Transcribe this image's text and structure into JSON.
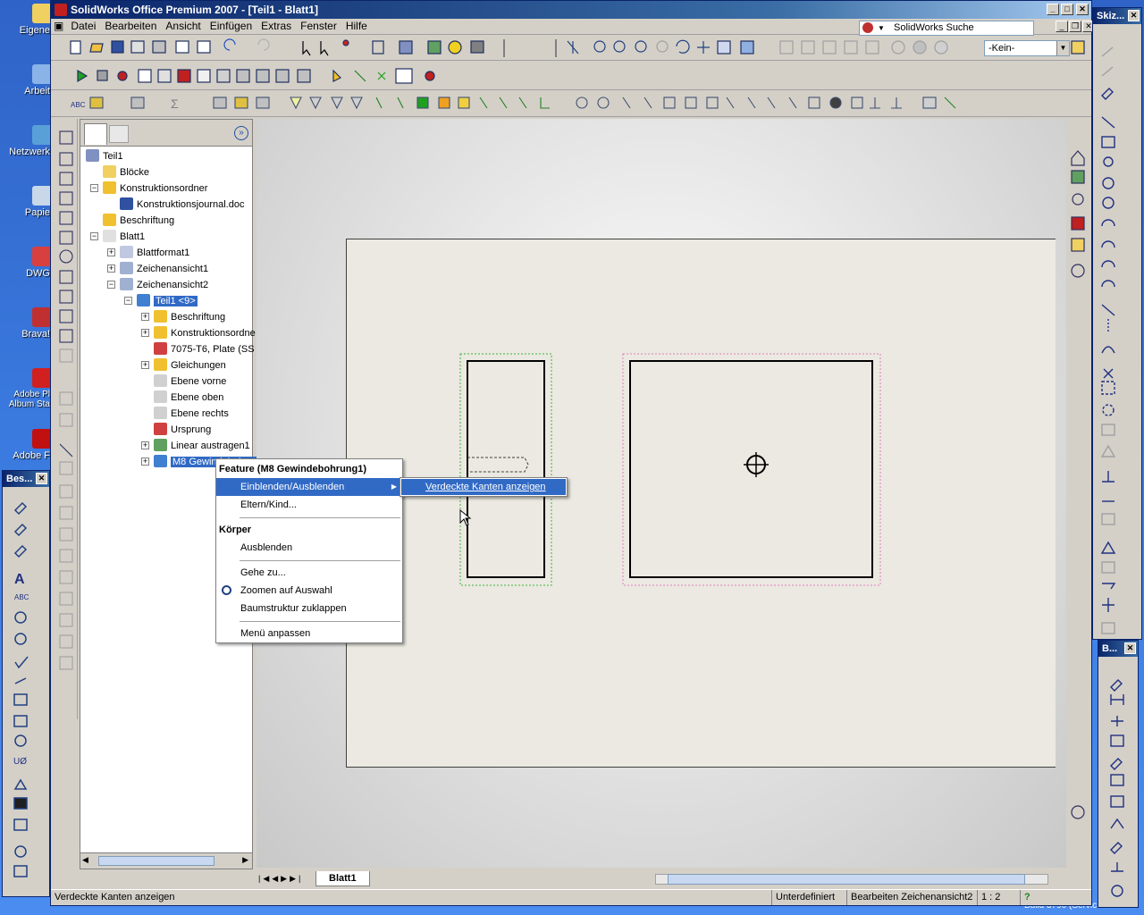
{
  "desktop": {
    "icons": [
      "Eigene",
      "Arbeit",
      "Netzwerk",
      "Papie",
      "DWG",
      "Brava!",
      "Adobe Pl Album Sta",
      "Adobe F"
    ],
    "bottom_text": "Build 3790 (Servic"
  },
  "window": {
    "title": "SolidWorks Office Premium 2007 - [Teil1 - Blatt1]",
    "search_placeholder": "SolidWorks Suche",
    "view_combo": "-Kein-"
  },
  "menu": [
    "Datei",
    "Bearbeiten",
    "Ansicht",
    "Einfügen",
    "Extras",
    "Fenster",
    "Hilfe"
  ],
  "tree": [
    {
      "label": "Teil1",
      "icon": "drawing-icon",
      "level": 0,
      "expand": ""
    },
    {
      "label": "Blöcke",
      "icon": "blocks-folder-icon",
      "level": 1,
      "expand": ""
    },
    {
      "label": "Konstruktionsordner",
      "icon": "design-binder-icon",
      "level": 1,
      "expand": "−"
    },
    {
      "label": "Konstruktionsjournal.doc",
      "icon": "word-document-icon",
      "level": 2,
      "expand": ""
    },
    {
      "label": "Beschriftung",
      "icon": "annotations-icon",
      "level": 1,
      "expand": ""
    },
    {
      "label": "Blatt1",
      "icon": "sheet-icon",
      "level": 1,
      "expand": "−"
    },
    {
      "label": "Blattformat1",
      "icon": "sheet-format-icon",
      "level": 2,
      "expand": "+"
    },
    {
      "label": "Zeichenansicht1",
      "icon": "drawing-view-icon",
      "level": 2,
      "expand": "+"
    },
    {
      "label": "Zeichenansicht2",
      "icon": "drawing-view-icon",
      "level": 2,
      "expand": "−"
    },
    {
      "label": "Teil1 <9>",
      "icon": "part-icon",
      "level": 3,
      "expand": "−",
      "selected": true
    },
    {
      "label": "Beschriftung",
      "icon": "annotations-icon",
      "level": 4,
      "expand": "+"
    },
    {
      "label": "Konstruktionsordne",
      "icon": "design-binder-icon",
      "level": 4,
      "expand": "+"
    },
    {
      "label": "7075-T6, Plate (SS",
      "icon": "material-icon",
      "level": 4,
      "expand": ""
    },
    {
      "label": "Gleichungen",
      "icon": "equations-icon",
      "level": 4,
      "expand": "+"
    },
    {
      "label": "Ebene vorne",
      "icon": "plane-icon",
      "level": 4,
      "expand": ""
    },
    {
      "label": "Ebene oben",
      "icon": "plane-icon",
      "level": 4,
      "expand": ""
    },
    {
      "label": "Ebene rechts",
      "icon": "plane-icon",
      "level": 4,
      "expand": ""
    },
    {
      "label": "Ursprung",
      "icon": "origin-icon",
      "level": 4,
      "expand": ""
    },
    {
      "label": "Linear austragen1",
      "icon": "extrude-icon",
      "level": 4,
      "expand": "+"
    },
    {
      "label": "M8 Gewindebohrung1",
      "icon": "hole-wizard-icon",
      "level": 4,
      "expand": "+",
      "selected": true
    }
  ],
  "context_menu": {
    "header_feature": "Feature (M8 Gewindebohrung1)",
    "show_hide": "Einblenden/Ausblenden",
    "parent_child": "Eltern/Kind...",
    "header_body": "Körper",
    "hide": "Ausblenden",
    "goto": "Gehe zu...",
    "zoom_selection": "Zoomen auf Auswahl",
    "collapse_tree": "Baumstruktur zuklappen",
    "customize_menu": "Menü anpassen"
  },
  "submenu": {
    "show_hidden_edges": "Verdeckte Kanten anzeigen"
  },
  "sheet_tab": "Blatt1",
  "status": {
    "message": "Verdeckte Kanten anzeigen",
    "state": "Unterdefiniert",
    "mode": "Bearbeiten Zeichenansicht2",
    "scale": "1 : 2",
    "help": "?"
  },
  "floating_toolbars": {
    "left": "Bes...",
    "right_top": "Skiz...",
    "right_bottom": "B..."
  },
  "colors": {
    "title_dark": "#0a246a",
    "selection": "#316ac5",
    "sheet": "#ebe9e1",
    "view_frame_green": "#3cb43c",
    "view_frame_pink": "#e080c0"
  }
}
